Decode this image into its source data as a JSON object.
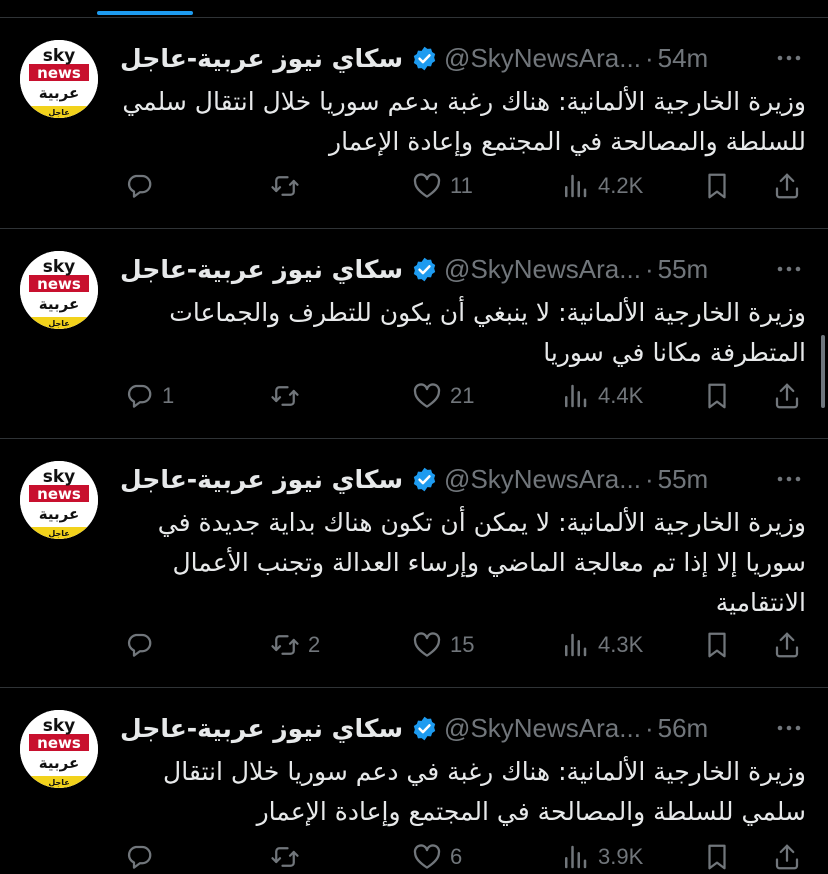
{
  "colors": {
    "accent": "#1d9bf0",
    "text": "#e7e9ea",
    "muted": "#71767b",
    "divider": "#2f3336",
    "avatar_red": "#c8102e",
    "avatar_yellow": "#f2d21b"
  },
  "avatar_text": {
    "line1": "sky",
    "line2": "news",
    "line3": "عربية",
    "line4": "عاجل"
  },
  "tweets": [
    {
      "author": "سكاي نيوز عربية-عاجل",
      "handle": "@SkyNewsAra...",
      "time": "54m",
      "text": "وزيرة الخارجية الألمانية: هناك رغبة بدعم سوريا خلال انتقال سلمي للسلطة والمصالحة في المجتمع وإعادة الإعمار",
      "replies": "",
      "retweets": "",
      "likes": "11",
      "views": "4.2K"
    },
    {
      "author": "سكاي نيوز عربية-عاجل",
      "handle": "@SkyNewsAra...",
      "time": "55m",
      "text": "وزيرة الخارجية الألمانية: لا ينبغي أن يكون للتطرف والجماعات المتطرفة مكانا في سوريا",
      "replies": "1",
      "retweets": "",
      "likes": "21",
      "views": "4.4K"
    },
    {
      "author": "سكاي نيوز عربية-عاجل",
      "handle": "@SkyNewsAra...",
      "time": "55m",
      "text": "وزيرة الخارجية الألمانية: لا يمكن أن تكون هناك بداية جديدة في سوريا إلا إذا تم معالجة الماضي وإرساء العدالة وتجنب الأعمال الانتقامية",
      "replies": "",
      "retweets": "2",
      "likes": "15",
      "views": "4.3K"
    },
    {
      "author": "سكاي نيوز عربية-عاجل",
      "handle": "@SkyNewsAra...",
      "time": "56m",
      "text": "وزيرة الخارجية الألمانية: هناك رغبة في دعم سوريا خلال انتقال سلمي للسلطة والمصالحة في المجتمع وإعادة الإعمار",
      "replies": "",
      "retweets": "",
      "likes": "6",
      "views": "3.9K"
    }
  ],
  "icons": {
    "verified": "verified-badge-icon",
    "more": "more-options-icon",
    "reply": "reply-icon",
    "retweet": "retweet-icon",
    "like": "heart-icon",
    "views": "views-icon",
    "bookmark": "bookmark-icon",
    "share": "share-icon"
  },
  "separator": "·"
}
